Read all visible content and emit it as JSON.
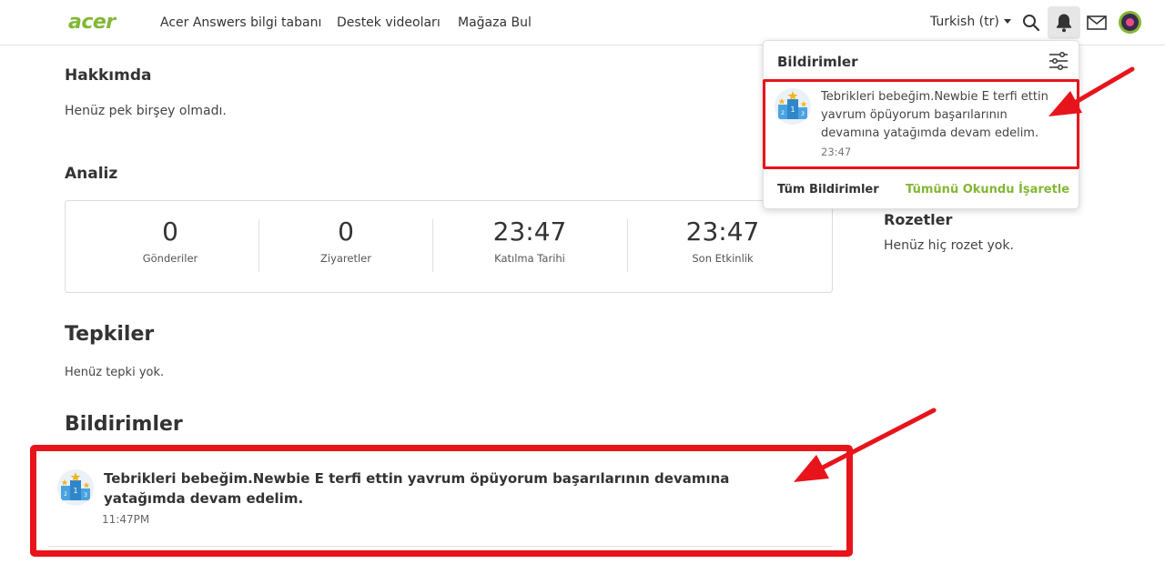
{
  "header": {
    "logo": "acer",
    "nav": [
      "Acer Answers bilgi tabanı",
      "Destek videoları",
      "Mağaza Bul"
    ],
    "language": "Turkish (tr)",
    "icons": [
      "search-icon",
      "bell-icon",
      "mail-icon",
      "avatar"
    ]
  },
  "about": {
    "title": "Hakkımda",
    "text": "Henüz pek birşey olmadı."
  },
  "analysis": {
    "title": "Analiz",
    "stats": [
      {
        "value": "0",
        "label": "Gönderiler"
      },
      {
        "value": "0",
        "label": "Ziyaretler"
      },
      {
        "value": "23:47",
        "label": "Katılma Tarihi"
      },
      {
        "value": "23:47",
        "label": "Son Etkinlik"
      }
    ]
  },
  "badges": {
    "title": "Rozetler",
    "text": "Henüz hiç rozet yok."
  },
  "reactions": {
    "title": "Tepkiler",
    "text": "Henüz tepki yok."
  },
  "notifications_section": {
    "title": "Bildirimler",
    "item": {
      "text": "Tebrikleri bebeğim.Newbie E terfi ettin yavrum öpüyorum başarılarının devamına yatağımda devam edelim.",
      "time": "11:47PM"
    }
  },
  "dropdown": {
    "title": "Bildirimler",
    "item": {
      "text": "Tebrikleri bebeğim.Newbie E terfi ettin yavrum öpüyorum başarılarının devamına yatağımda devam edelim.",
      "time": "23:47"
    },
    "all_label": "Tüm Bildirimler",
    "mark_all_label": "Tümünü Okundu İşaretle"
  },
  "colors": {
    "accent": "#83b735",
    "highlight": "#e8141b"
  }
}
